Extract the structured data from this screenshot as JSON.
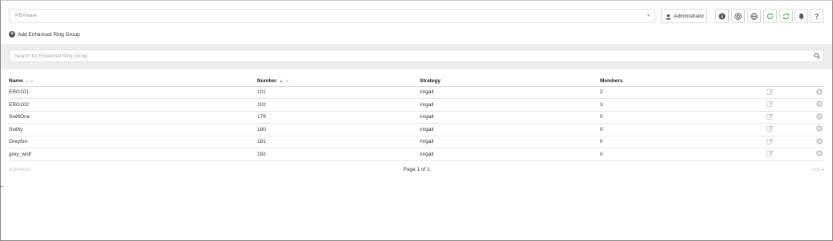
{
  "header": {
    "pbx_select": {
      "placeholder": "PBXware"
    },
    "user_button": {
      "label": "Administrator"
    },
    "icon_buttons": [
      {
        "icon": "info-icon",
        "color": "#555555"
      },
      {
        "icon": "settings-icon",
        "color": "#555555"
      },
      {
        "icon": "globe-icon",
        "color": "#555555"
      },
      {
        "icon": "reload-icon",
        "color": "#5cb85c"
      },
      {
        "icon": "sync-icon",
        "color": "#5cb85c"
      },
      {
        "icon": "bell-icon",
        "color": "#555555"
      },
      {
        "icon": "help-icon",
        "color": "#555555"
      }
    ]
  },
  "toolbar": {
    "add_label": "Add Enhanced Ring Group"
  },
  "search": {
    "placeholder": "Search for Enhanced Ring Group"
  },
  "table": {
    "columns": {
      "name": "Name",
      "number": "Number",
      "strategy": "Strategy",
      "members": "Members"
    },
    "sort": {
      "column": "number",
      "direction": "asc"
    },
    "rows": [
      {
        "name": "ERG101",
        "number": "101",
        "strategy": "ringall",
        "members": "2"
      },
      {
        "name": "ERG102",
        "number": "102",
        "strategy": "ringall",
        "members": "3"
      },
      {
        "name": "SwiftOne",
        "number": "179",
        "strategy": "ringall",
        "members": "0"
      },
      {
        "name": "Swifty",
        "number": "180",
        "strategy": "ringall",
        "members": "0"
      },
      {
        "name": "Greyfon",
        "number": "181",
        "strategy": "ringall",
        "members": "0"
      },
      {
        "name": "grey_wolf",
        "number": "182",
        "strategy": "ringall",
        "members": "0"
      }
    ]
  },
  "pager": {
    "previous": "previous",
    "info": "Page 1 of 1",
    "next": "next"
  },
  "colors": {
    "accent_green": "#5cb85c",
    "band": "#eeeeee",
    "border": "#d6d6d6"
  }
}
